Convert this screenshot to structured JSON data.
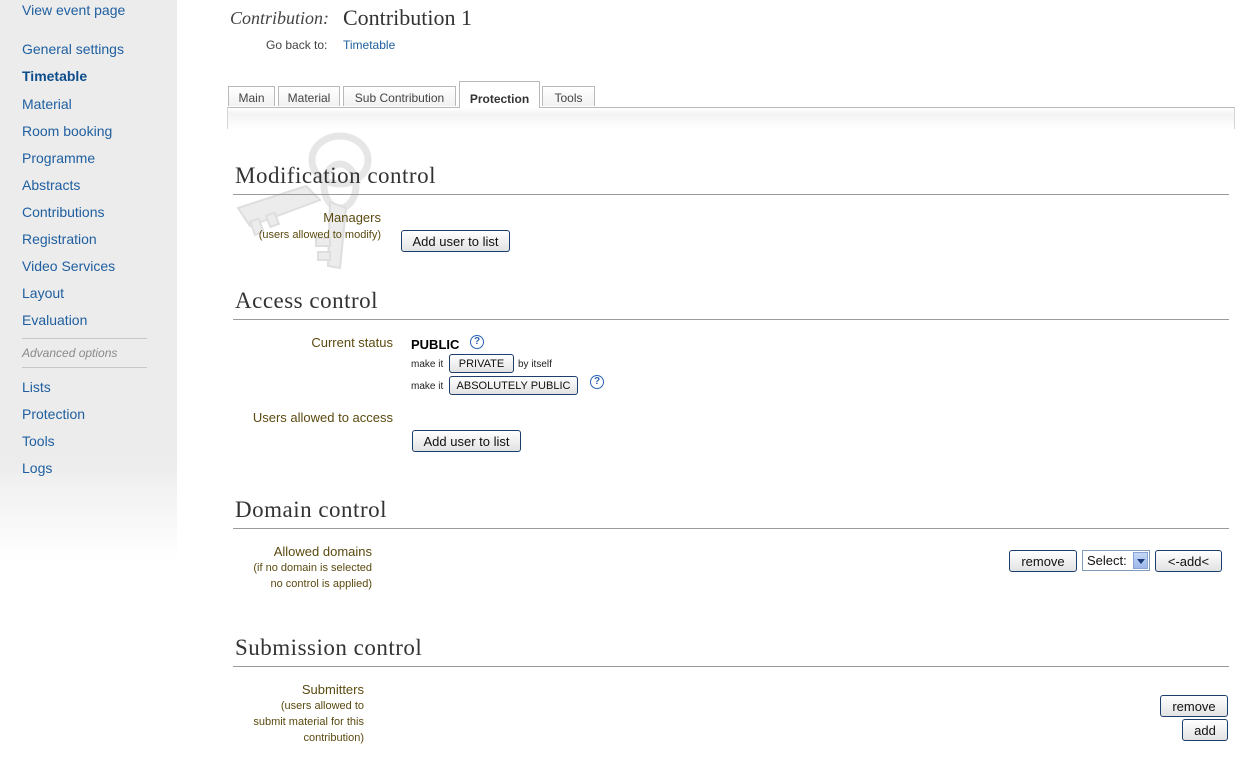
{
  "sidebar": {
    "items": [
      {
        "label": "View event page"
      },
      {
        "label": "General settings"
      },
      {
        "label": "Timetable"
      },
      {
        "label": "Material"
      },
      {
        "label": "Room booking"
      },
      {
        "label": "Programme"
      },
      {
        "label": "Abstracts"
      },
      {
        "label": "Contributions"
      },
      {
        "label": "Registration"
      },
      {
        "label": "Video Services"
      },
      {
        "label": "Layout"
      },
      {
        "label": "Evaluation"
      }
    ],
    "advanced_label": "Advanced options",
    "advanced_items": [
      {
        "label": "Lists"
      },
      {
        "label": "Protection"
      },
      {
        "label": "Tools"
      },
      {
        "label": "Logs"
      }
    ]
  },
  "header": {
    "contribution_label": "Contribution:",
    "contribution_title": "Contribution 1",
    "go_back_label": "Go back to:",
    "go_back_link": "Timetable"
  },
  "tabs": [
    {
      "label": "Main"
    },
    {
      "label": "Material"
    },
    {
      "label": "Sub Contribution"
    },
    {
      "label": "Protection"
    },
    {
      "label": "Tools"
    }
  ],
  "modification": {
    "title": "Modification control",
    "managers_label": "Managers",
    "managers_sub": "(users allowed to modify)",
    "add_user_button": "Add user to list"
  },
  "access": {
    "title": "Access control",
    "current_status_label": "Current status",
    "status_value": "PUBLIC",
    "help_glyph": "?",
    "make_it_1": "make it",
    "private_button": "PRIVATE",
    "by_itself": "by itself",
    "make_it_2": "make it",
    "absolutely_public_button": "ABSOLUTELY PUBLIC",
    "users_allowed_label": "Users allowed to access",
    "add_user_button": "Add user to list"
  },
  "domain": {
    "title": "Domain control",
    "allowed_label": "Allowed domains",
    "sub_line1": "(if no domain is selected",
    "sub_line2": "no control is applied)",
    "remove_button": "remove",
    "select_value": "Select:",
    "add_button": "<-add<"
  },
  "submission": {
    "title": "Submission control",
    "submitters_label": "Submitters",
    "sub_line1": "(users allowed to",
    "sub_line2": "submit material for this",
    "sub_line3": "contribution)",
    "remove_button": "remove",
    "add_button": "add"
  },
  "colors": {
    "link": "#1f5fa0",
    "label": "#5b4a10",
    "sidebar_bg": "#ececec"
  }
}
